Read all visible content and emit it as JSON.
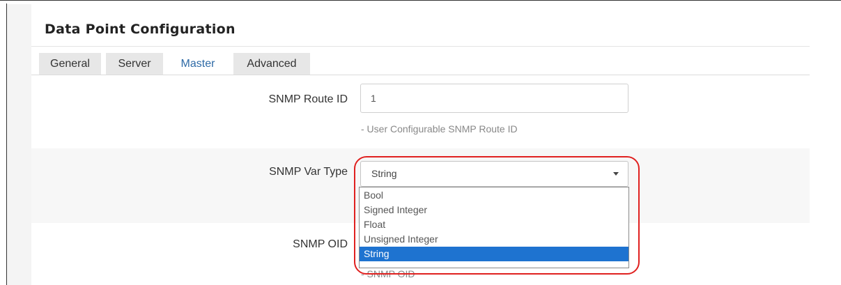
{
  "panel": {
    "title": "Data Point Configuration"
  },
  "tabs": [
    {
      "label": "General",
      "active": false
    },
    {
      "label": "Server",
      "active": false
    },
    {
      "label": "Master",
      "active": true
    },
    {
      "label": "Advanced",
      "active": false
    }
  ],
  "route_id": {
    "label": "SNMP Route ID",
    "value": "1",
    "help": "- User Configurable SNMP Route ID"
  },
  "var_type": {
    "label": "SNMP Var Type",
    "selected": "String",
    "options": [
      "Bool",
      "Signed Integer",
      "Float",
      "Unsigned Integer",
      "String"
    ]
  },
  "oid": {
    "label": "SNMP OID",
    "help": "- SNMP OID"
  },
  "colors": {
    "highlight_ring": "#e0201f",
    "selected_option": "#1e73d0",
    "active_tab_text": "#2e6aa6"
  }
}
